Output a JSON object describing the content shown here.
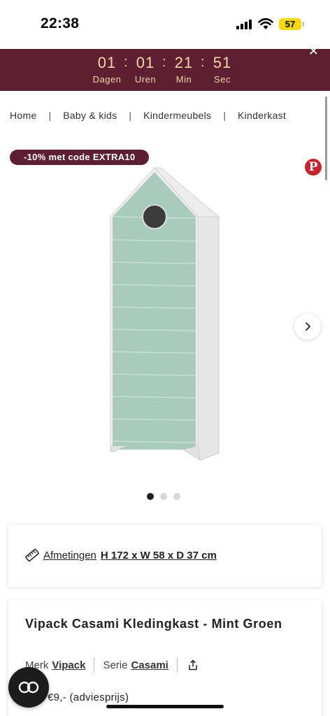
{
  "status_bar": {
    "time": "22:38",
    "battery": "57"
  },
  "countdown": {
    "units": [
      {
        "value": "01",
        "label": "Dagen"
      },
      {
        "value": "01",
        "label": "Uren"
      },
      {
        "value": "21",
        "label": "Min"
      },
      {
        "value": "51",
        "label": "Sec"
      }
    ],
    "separator": ":"
  },
  "breadcrumb": {
    "items": [
      "Home",
      "Baby & kids",
      "Kindermeubels",
      "Kinderkast"
    ],
    "separator": "|"
  },
  "promo_badge": "-10% met code EXTRA10",
  "gallery": {
    "total_images": 3,
    "active_index": 0
  },
  "dimensions": {
    "label": "Afmetingen",
    "value": "H 172 x W 58 x D 37 cm"
  },
  "product": {
    "title": "Vipack Casami Kledingkast - Mint Groen",
    "brand_label": "Merk",
    "brand": "Vipack",
    "series_label": "Serie",
    "series": "Casami",
    "price_text": "€9,- (adviesprijs)"
  },
  "icons": {
    "pinterest": "pinterest-icon",
    "next": "chevron-right-icon",
    "ruler": "ruler-icon",
    "share": "share-icon",
    "chat": "chat-icon",
    "close": "close-icon"
  },
  "colors": {
    "brand": "#5e1f33",
    "countdown_text": "#f3d7a6",
    "cabinet_mint": "#a9cbbd",
    "pinterest": "#c8232c"
  }
}
